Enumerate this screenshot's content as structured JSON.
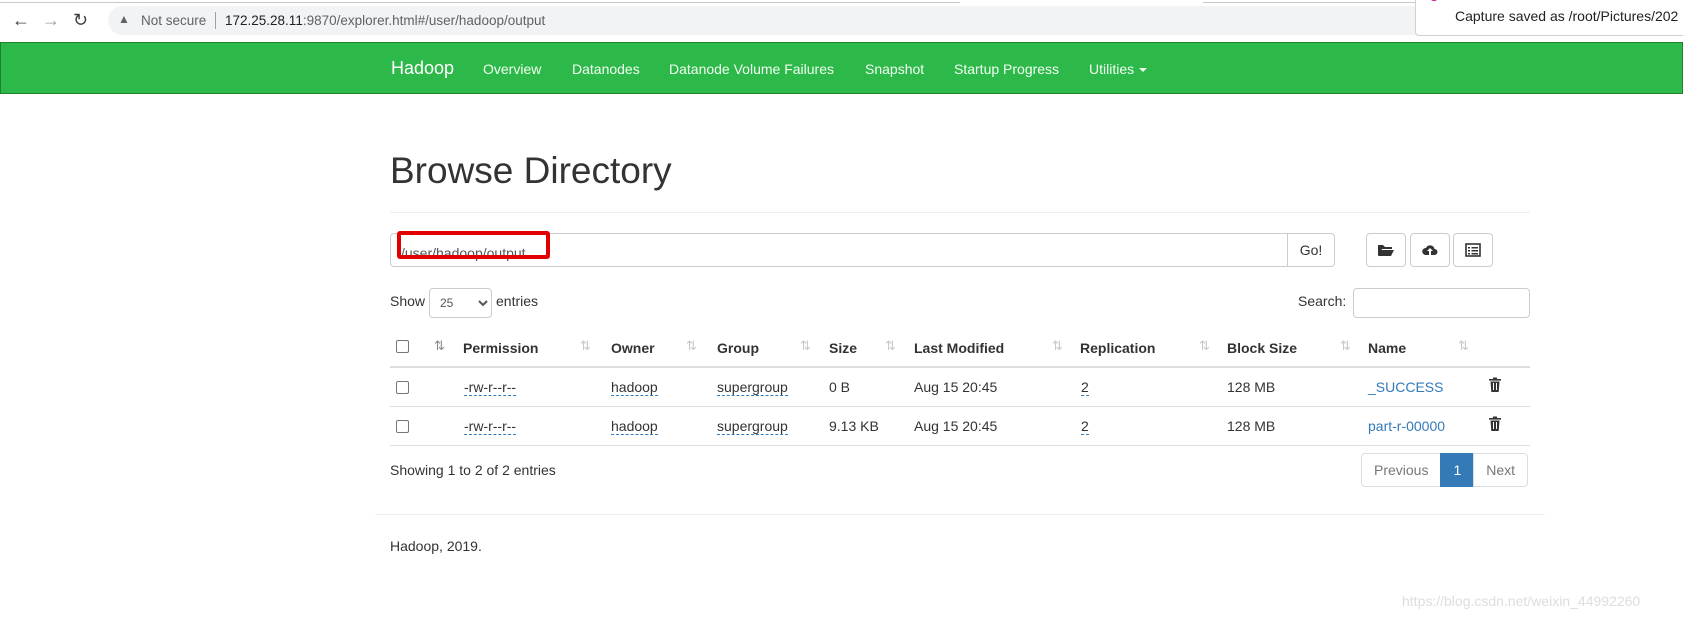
{
  "browser": {
    "back_icon": "←",
    "forward_icon": "→",
    "reload_icon": "↻",
    "warning_icon": "▲",
    "not_secure": "Not secure",
    "url_host": "172.25.28.11",
    "url_rest": ":9870/explorer.html#/user/hadoop/output"
  },
  "notification": {
    "message": "Capture saved as /root/Pictures/202"
  },
  "navbar": {
    "brand": "Hadoop",
    "items": [
      "Overview",
      "Datanodes",
      "Datanode Volume Failures",
      "Snapshot",
      "Startup Progress",
      "Utilities"
    ]
  },
  "page": {
    "title": "Browse Directory",
    "path_value": "/user/hadoop/output",
    "go_label": "Go!"
  },
  "controls": {
    "show_label": "Show",
    "entries_value": "25",
    "entries_label": "entries",
    "search_label": "Search:"
  },
  "table": {
    "columns": [
      "Permission",
      "Owner",
      "Group",
      "Size",
      "Last Modified",
      "Replication",
      "Block Size",
      "Name"
    ],
    "rows": [
      {
        "permission": "-rw-r--r--",
        "owner": "hadoop",
        "group": "supergroup",
        "size": "0 B",
        "last_modified": "Aug 15 20:45",
        "replication": "2",
        "block_size": "128 MB",
        "name": "_SUCCESS"
      },
      {
        "permission": "-rw-r--r--",
        "owner": "hadoop",
        "group": "supergroup",
        "size": "9.13 KB",
        "last_modified": "Aug 15 20:45",
        "replication": "2",
        "block_size": "128 MB",
        "name": "part-r-00000"
      }
    ]
  },
  "summary": "Showing 1 to 2 of 2 entries",
  "pagination": {
    "previous": "Previous",
    "current": "1",
    "next": "Next"
  },
  "footer": "Hadoop, 2019.",
  "watermark": "https://blog.csdn.net/weixin_44992260",
  "colors": {
    "navbar": "#2db84a",
    "link": "#337ab7",
    "highlight": "#e00000"
  }
}
